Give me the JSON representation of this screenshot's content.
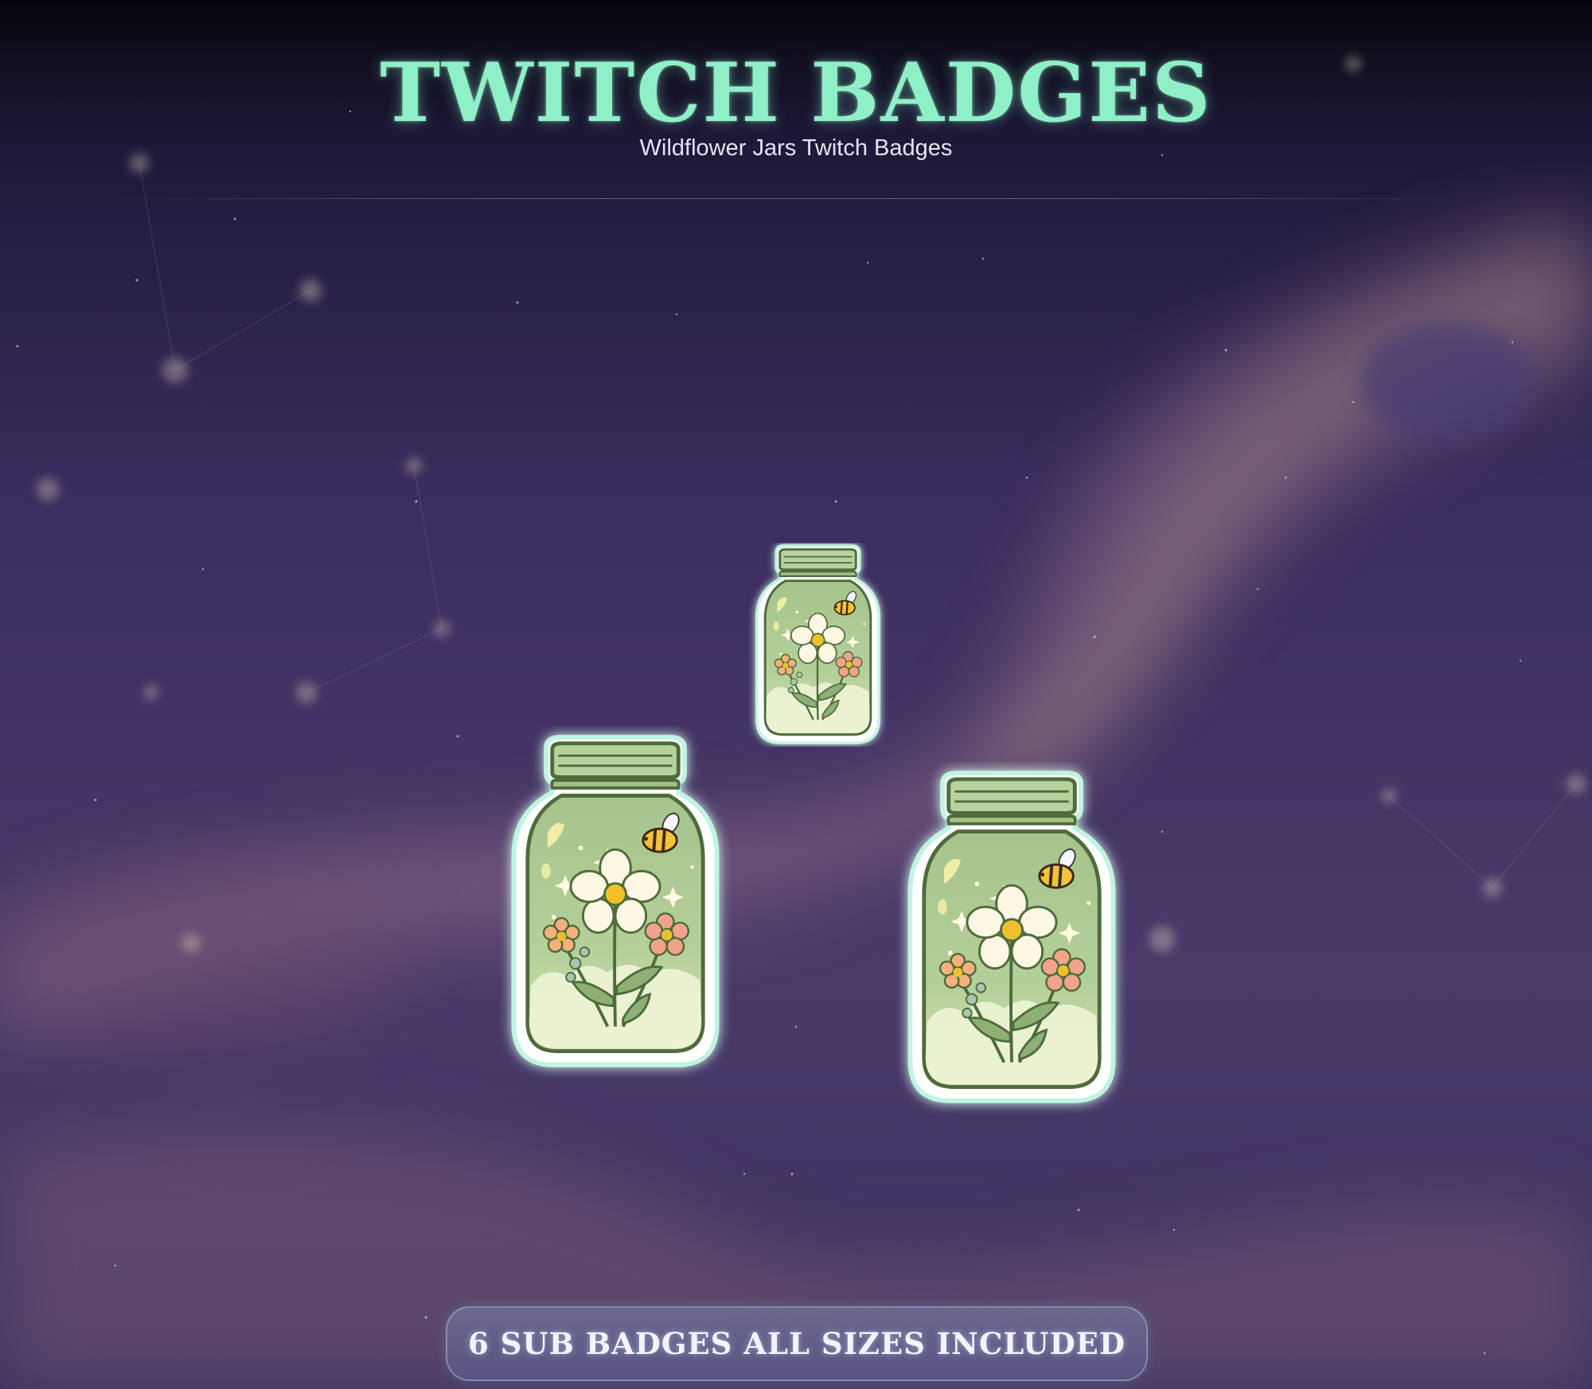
{
  "header": {
    "title": "TWITCH BADGES",
    "subtitle": "Wildflower Jars Twitch Badges"
  },
  "badges": [
    {
      "name": "small-jar-badge",
      "icon": "flower-jar-icon"
    },
    {
      "name": "large-jar-badge-left",
      "icon": "flower-jar-icon"
    },
    {
      "name": "large-jar-badge-right",
      "icon": "flower-jar-icon"
    }
  ],
  "banner": {
    "text": "6 SUB BADGES ALL SIZES INCLUDED"
  },
  "colors": {
    "title": "#8ff0c8",
    "background": "#2a2450",
    "jar_green": "#a9c58e",
    "jar_outline": "#4e6b3c"
  }
}
